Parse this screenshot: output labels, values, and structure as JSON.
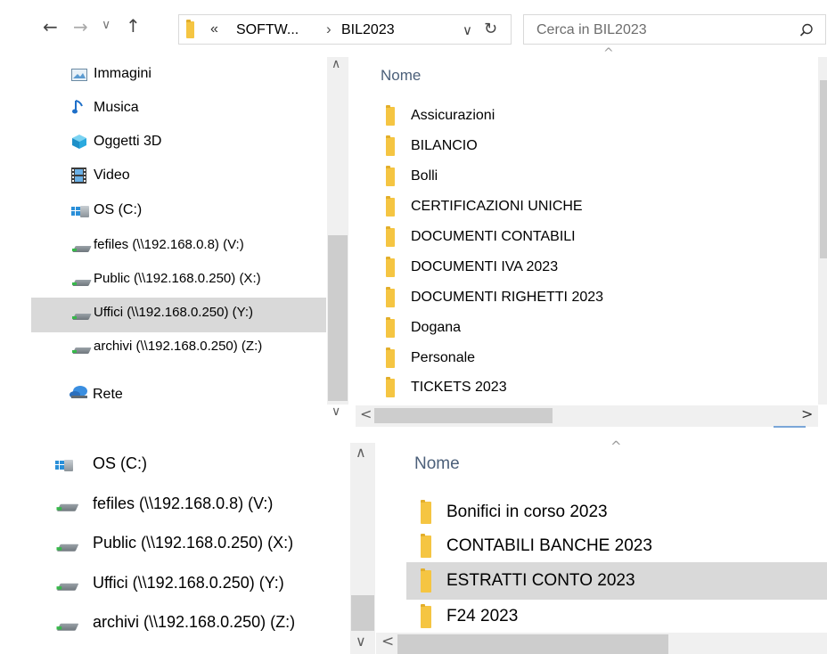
{
  "toolbar": {
    "back_icon": "arrow-left-icon",
    "forward_icon": "arrow-right-icon",
    "recent_icon": "chevron-down-icon",
    "up_icon": "arrow-up-icon",
    "breadcrumb_overflow": "«",
    "breadcrumb_1": "SOFTW...",
    "breadcrumb_sep": "›",
    "breadcrumb_2": "BIL2023",
    "address_dropdown": "∨",
    "refresh": "↻",
    "search_placeholder": "Cerca in BIL2023",
    "search_icon": "⌕"
  },
  "top": {
    "nav_items": [
      {
        "label": "Immagini",
        "icon": "pictures-icon"
      },
      {
        "label": "Musica",
        "icon": "music-icon"
      },
      {
        "label": "Oggetti 3D",
        "icon": "3d-objects-icon"
      },
      {
        "label": "Video",
        "icon": "video-icon"
      },
      {
        "label": "OS (C:)",
        "icon": "os-drive-icon"
      },
      {
        "label": "fefiles (\\\\192.168.0.8) (V:)",
        "icon": "network-drive-icon"
      },
      {
        "label": "Public (\\\\192.168.0.250) (X:)",
        "icon": "network-drive-icon"
      },
      {
        "label": "Uffici (\\\\192.168.0.250) (Y:)",
        "icon": "network-drive-icon",
        "selected": true
      },
      {
        "label": "archivi (\\\\192.168.0.250) (Z:)",
        "icon": "network-drive-icon"
      },
      {
        "label": "Rete",
        "icon": "network-icon"
      }
    ],
    "column_header": "Nome",
    "files": [
      "Assicurazioni",
      "BILANCIO",
      "Bolli",
      "CERTIFICAZIONI UNICHE",
      "DOCUMENTI CONTABILI",
      "DOCUMENTI IVA 2023",
      "DOCUMENTI RIGHETTI 2023",
      "Dogana",
      "Personale",
      "TICKETS 2023"
    ]
  },
  "bottom": {
    "nav_items": [
      {
        "label": "OS (C:)",
        "icon": "os-drive-icon"
      },
      {
        "label": "fefiles (\\\\192.168.0.8) (V:)",
        "icon": "network-drive-icon"
      },
      {
        "label": "Public (\\\\192.168.0.250) (X:)",
        "icon": "network-drive-icon"
      },
      {
        "label": "Uffici (\\\\192.168.0.250) (Y:)",
        "icon": "network-drive-icon"
      },
      {
        "label": "archivi (\\\\192.168.0.250) (Z:)",
        "icon": "network-drive-icon"
      }
    ],
    "column_header": "Nome",
    "files": [
      {
        "label": "Bonifici in corso 2023"
      },
      {
        "label": "CONTABILI BANCHE 2023"
      },
      {
        "label": "ESTRATTI CONTO 2023",
        "selected": true
      },
      {
        "label": "F24 2023"
      }
    ]
  },
  "colors": {
    "selection": "#d9d9d9",
    "folder": "#f5c542",
    "header_text": "#4c607a"
  }
}
